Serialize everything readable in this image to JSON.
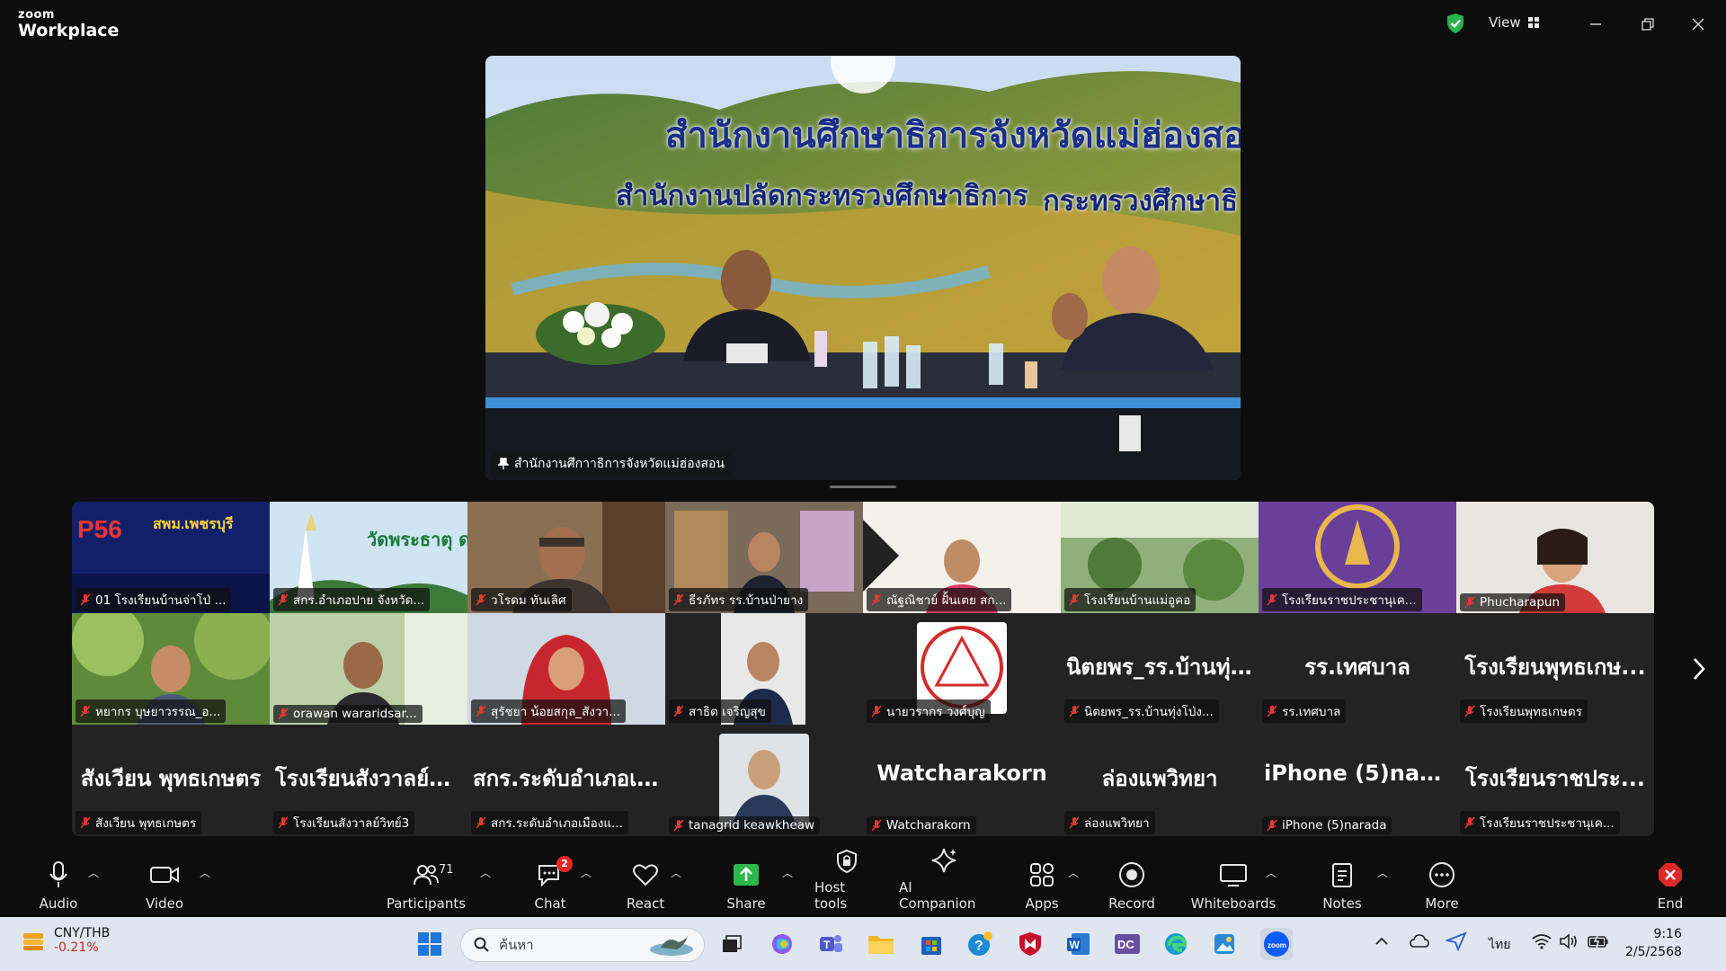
{
  "app": {
    "brand_small": "zoom",
    "brand_large": "Workplace",
    "view_label": "View"
  },
  "speaker": {
    "banner_line1": "สำนักงานศึกษาธิการจังหวัดแม่ฮ่องสอน",
    "banner_line2": "สำนักงานปลัดกระทรวงศึกษาธิการ",
    "banner_line3": "กระทรวงศึกษาธิ",
    "name": "สำนักงานศึกาาธิการจังหวัดแม่ฮ่องสอน"
  },
  "gallery": {
    "tiles": [
      {
        "label": "01 โรงเรียนบ้านจ่าโป่ ..."
      },
      {
        "label": "สกร.อำเภอปาย จังหวัด...",
        "overlay": "วัดพระธาตุ ดอยกองมู"
      },
      {
        "label": "วโรดม ทันเลิศ"
      },
      {
        "label": "ธีรภัทร รร.บ้านป่ายาง"
      },
      {
        "label": "ณัฐณิชาย์ ฝั้นเตย สก..."
      },
      {
        "label": "โรงเรียนบ้านแม่อูคอ"
      },
      {
        "label": "โรงเรียนราชประชานุเค..."
      },
      {
        "label": "Phucharapun"
      },
      {
        "label": "หยากร บุษยาวรรณ_อ..."
      },
      {
        "label": "orawan wararidsar..."
      },
      {
        "label": "สุรัชยา น้อยสกุล_สังวา..."
      },
      {
        "label": "สาธิต เจริญสุข"
      },
      {
        "label": "นายวรากร วงศ์บุญ"
      },
      {
        "label": "นิตยพร_รร.บ้านทุ่งโป่ง...",
        "big": "นิตยพร_รร.บ้านทุ่..."
      },
      {
        "label": "รร.เทศบาล",
        "big": "รร.เทศบาล"
      },
      {
        "label": "โรงเรียนพุทธเกษตร",
        "big": "โรงเรียนพุทธเกษ..."
      },
      {
        "label": "สังเวียน พุทธเกษตร",
        "big": "สังเวียน พุทธเกษตร"
      },
      {
        "label": "โรงเรียนสังวาลย์วิทย์3",
        "big": "โรงเรียนสังวาลย์วิ..."
      },
      {
        "label": "สกร.ระดับอำเภอเมืองแ...",
        "big": "สกร.ระดับอำเภอเ..."
      },
      {
        "label": "tanagrid keawkheaw"
      },
      {
        "label": "Watcharakorn",
        "big": "Watcharakorn"
      },
      {
        "label": "ล่องแพวิทยา",
        "big": "ล่องแพวิทยา"
      },
      {
        "label": "iPhone (5)narada",
        "big": "iPhone (5)narada"
      },
      {
        "label": "โรงเรียนราชประชานุเค...",
        "big": "โรงเรียนราชประ..."
      }
    ]
  },
  "toolbar": {
    "audio": "Audio",
    "video": "Video",
    "participants": "Participants",
    "participants_count": "71",
    "chat": "Chat",
    "chat_badge": "2",
    "react": "React",
    "share": "Share",
    "host_tools": "Host tools",
    "ai_companion": "AI Companion",
    "apps": "Apps",
    "record": "Record",
    "whiteboards": "Whiteboards",
    "notes": "Notes",
    "more": "More",
    "end": "End"
  },
  "taskbar": {
    "ticker_pair": "CNY/THB",
    "ticker_change": "-0.21%",
    "search_placeholder": "ค้นหา",
    "language": "ไทย",
    "time": "9:16",
    "date": "2/5/2568"
  },
  "colors": {
    "share_green": "#2db84b",
    "end_red": "#e02828",
    "shield_green": "#2bb24c",
    "mic_off_red": "#e53935"
  }
}
